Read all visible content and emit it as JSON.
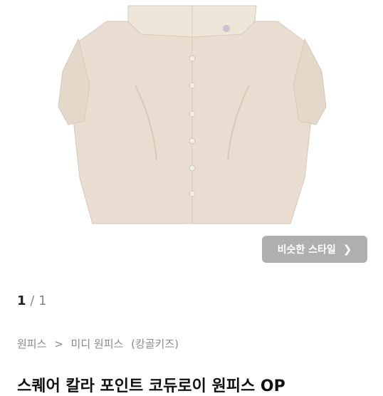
{
  "product": {
    "image_alt": "beige quilted collar shirt dress",
    "colors": {
      "fabric": "#e8ddd0",
      "shadow": "#d6c9b8",
      "button": "#f3ede4",
      "logo": "#c9c2cf"
    }
  },
  "similar_style": {
    "label": "비슷한 스타일",
    "icon": "chevron-right-icon"
  },
  "pager": {
    "current": "1",
    "separator": "/",
    "total": "1"
  },
  "breadcrumb": {
    "parent": "원피스",
    "separator": ">",
    "child": "미디 원피스",
    "brand": "(캉골키즈)"
  },
  "title": "스퀘어 칼라 포인트 코듀로이 원피스 OP"
}
